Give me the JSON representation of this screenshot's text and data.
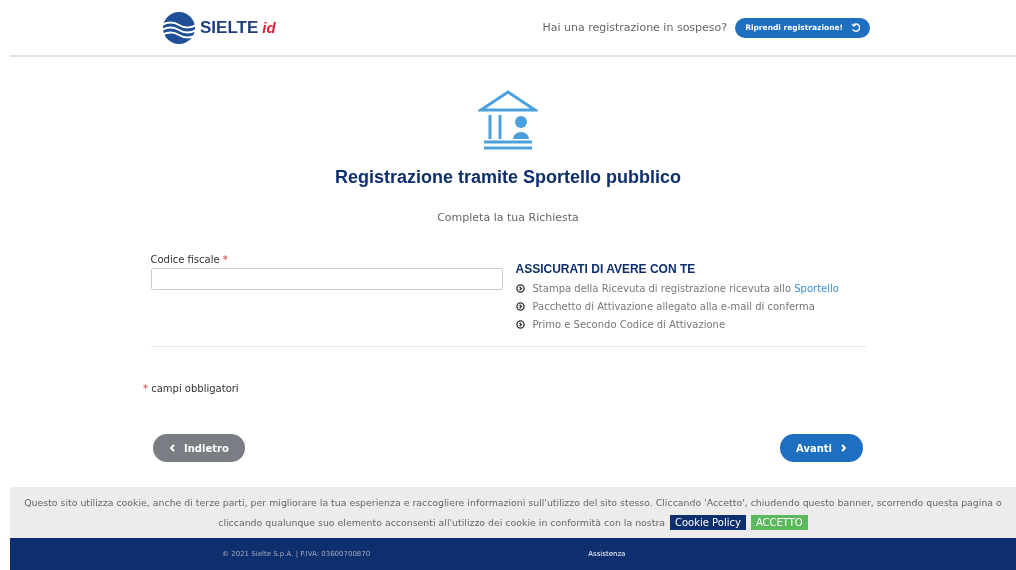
{
  "header": {
    "logo": {
      "text": "SIELTE",
      "suffix": "id"
    },
    "pending_question": "Hai una registrazione in sospeso?",
    "resume_button": "Riprendi registrazione!"
  },
  "title": "Registrazione tramite Sportello pubblico",
  "subtitle": "Completa la tua Richiesta",
  "form": {
    "field_label": "Codice fiscale",
    "required_mark": "*"
  },
  "checklist": {
    "heading": "ASSICURATI DI AVERE CON TE",
    "items": [
      {
        "text": "Stampa della Ricevuta di registrazione ricevuta allo",
        "link": "Sportello"
      },
      {
        "text": "Pacchetto di Attivazione allegato alla e-mail di conferma"
      },
      {
        "text": "Primo e Secondo Codice di Attivazione"
      }
    ]
  },
  "required_note": {
    "mark": "*",
    "text": "campi obbligatori"
  },
  "nav": {
    "back": "Indietro",
    "next": "Avanti"
  },
  "cookie_banner": {
    "text": "Questo sito utilizza cookie, anche di terze parti, per migliorare la tua esperienza e raccogliere informazioni sull'utilizzo del sito stesso. Cliccando 'Accetto', chiudendo questo banner, scorrendo questa pagina o cliccando qualunque suo elemento acconsenti all'utilizzo dei cookie in conformità con la nostra",
    "policy_button": "Cookie Policy",
    "accept_button": "ACCETTO"
  },
  "footer": {
    "copyright": "© 2021 Sielte S.p.A. | P.IVA: 03600700870",
    "link": "Assistenza"
  }
}
